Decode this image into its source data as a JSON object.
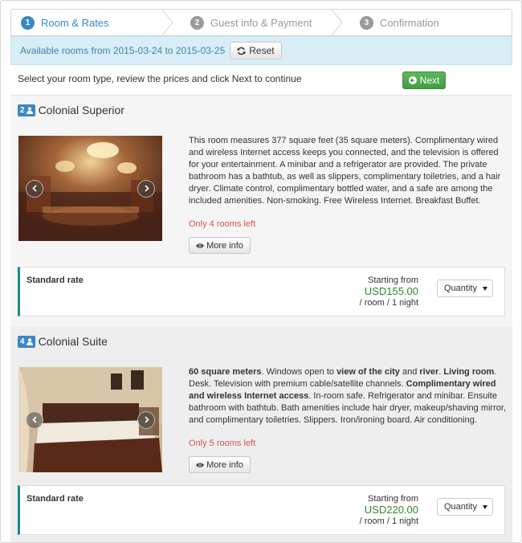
{
  "steps": [
    {
      "num": "1",
      "label": "Room & Rates",
      "active": true
    },
    {
      "num": "2",
      "label": "Guest info & Payment",
      "active": false
    },
    {
      "num": "3",
      "label": "Confirmation",
      "active": false
    }
  ],
  "availability": {
    "text": "Available rooms from 2015-03-24 to 2015-03-25",
    "reset_label": "Reset"
  },
  "instruction": {
    "text": "Select your room type, review the prices and click Next to continue",
    "next_label": "Next"
  },
  "rooms": [
    {
      "capacity": "2",
      "name": "Colonial Superior",
      "description": "This room measures 377 square feet (35 square meters). Complimentary wired and wireless Internet access keeps you connected, and the television is offered for your entertainment. A minibar and a refrigerator are provided. The private bathroom has a bathtub, as well as slippers, complimentary toiletries, and a hair dryer. Climate control, complimentary bottled water, and a safe are among the included amenities. Non-smoking. Free Wireless Internet. Breakfast Buffet.",
      "rooms_left": "Only 4 rooms left",
      "more_info_label": "More info",
      "rate": {
        "name": "Standard rate",
        "starting_from": "Starting from",
        "price": "USD155.00",
        "per": "/ room / 1 night",
        "quantity_placeholder": "Quantity"
      }
    },
    {
      "capacity": "4",
      "name": "Colonial Suite",
      "description_parts": [
        {
          "b": true,
          "t": "60 square meters"
        },
        {
          "b": false,
          "t": ". Windows open to "
        },
        {
          "b": true,
          "t": "view of the city"
        },
        {
          "b": false,
          "t": " and "
        },
        {
          "b": true,
          "t": "river"
        },
        {
          "b": false,
          "t": ". "
        },
        {
          "b": true,
          "t": "Living room"
        },
        {
          "b": false,
          "t": ". Desk. Television with premium cable/satellite channels. "
        },
        {
          "b": true,
          "t": "Complimentary wired and wireless Internet access"
        },
        {
          "b": false,
          "t": ". In-room safe. Refrigerator and minibar. Ensuite bathroom with bathtub. Bath amenities include hair dryer, makeup/shaving mirror, and complimentary toiletries. Slippers. Iron/ironing board. Air conditioning."
        }
      ],
      "rooms_left": "Only 5 rooms left",
      "more_info_label": "More info",
      "rate": {
        "name": "Standard rate",
        "starting_from": "Starting from",
        "price": "USD220.00",
        "per": "/ room / 1 night",
        "quantity_placeholder": "Quantity"
      }
    }
  ],
  "colors": {
    "accent": "#3a87c7",
    "success": "#5cb85c",
    "price": "#2a8a2a",
    "warning": "#d9534f",
    "rate_border": "#1a8a8a"
  }
}
